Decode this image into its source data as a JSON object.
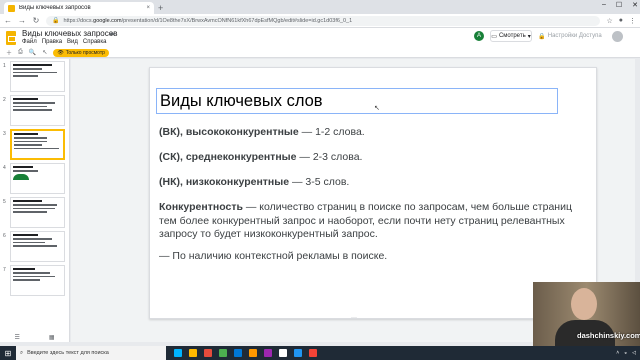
{
  "browser": {
    "tab_title": "Виды ключевых запросов",
    "tab_close": "×",
    "new_tab": "+",
    "url_prefix": "https://docs.",
    "url_host": "google.com",
    "url_rest": "/presentation/d/1Oe8the7xX/BrwxAvmcONfN61kfXh67dpEsfMQgb/edit#slide=id.gc1d03f6_0_1",
    "window_controls": [
      "–",
      "☐",
      "✕"
    ]
  },
  "docs": {
    "title": "Виды ключевых запросов",
    "menus": [
      "Файл",
      "Правка",
      "Вид",
      "Справка"
    ],
    "avatar_letter": "A",
    "view_button": "Смотреть",
    "access_button": "Настройки Доступа",
    "view_only_label": "Только просмотр",
    "accent": "#fbbc04"
  },
  "filmstrip": {
    "slide_numbers": [
      "1",
      "2",
      "3",
      "4",
      "5",
      "6",
      "7"
    ],
    "selected_index": 3
  },
  "slide": {
    "title": "Виды ключевых слов",
    "lines": [
      {
        "bold": "(ВК), высококонкурентные",
        "rest": " — 1-2 слова."
      },
      {
        "bold": "(СК), среднеконкурентные",
        "rest": " — 2-3 слова."
      },
      {
        "bold": "(НК), низкоконкурентные",
        "rest": " — 3-5 слов."
      }
    ],
    "paragraph_bold": "Конкурентность",
    "paragraph_line1": " — количество страниц в поиске по запросам, чем больше страниц",
    "paragraph_line2": "тем более конкурентный запрос и наоборот, если почти нету страниц релевантных",
    "paragraph_line3": "запросу то будет низкоконкурентный запрос.",
    "footer_line": "— По наличию контекстной рекламы в поиске."
  },
  "webcam": {
    "watermark": "dashchinskiy.com"
  },
  "taskbar": {
    "search_placeholder": "Введите здесь текст для поиска",
    "icon_colors": [
      "#00b4ff",
      "#ffb900",
      "#e74c3c",
      "#4caf50",
      "#0078d7",
      "#ff9800",
      "#9c27b0",
      "#ffffff",
      "#2196f3",
      "#f44336"
    ]
  }
}
